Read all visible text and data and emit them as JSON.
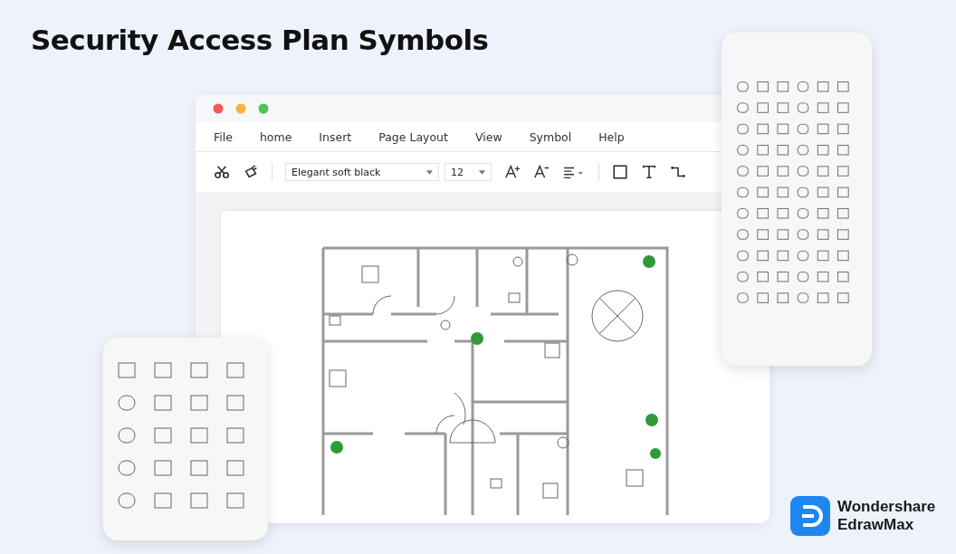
{
  "title": "Security Access Plan Symbols",
  "window": {
    "menu": [
      "File",
      "home",
      "Insert",
      "Page Layout",
      "View",
      "Symbol",
      "Help"
    ],
    "toolbar": {
      "font": "Elegant soft black",
      "size": "12"
    }
  },
  "brand": {
    "line_1": "Wondershare",
    "line_2": "EdrawMax"
  }
}
